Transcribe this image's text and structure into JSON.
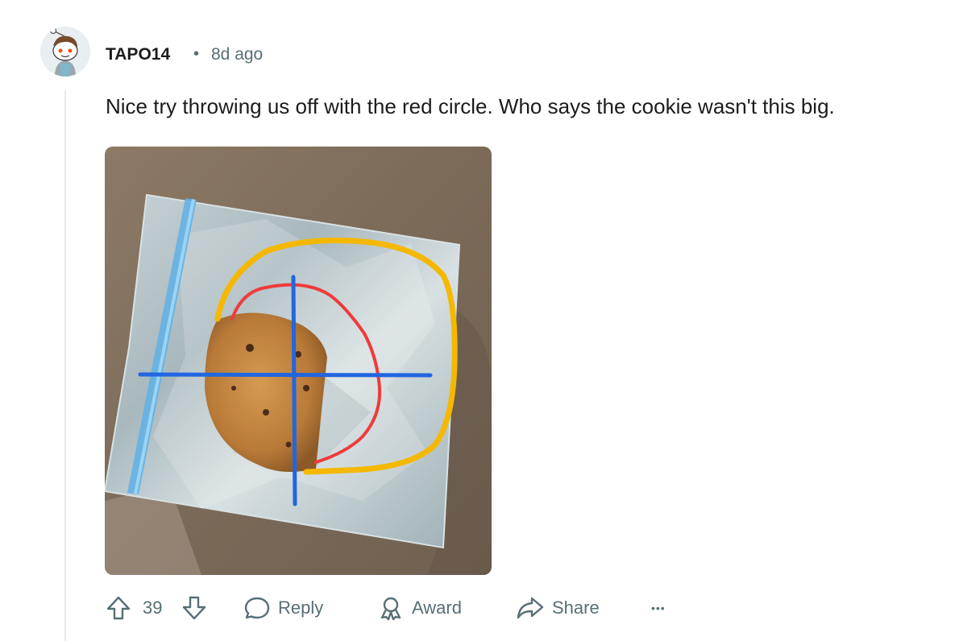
{
  "comment": {
    "username": "TAPO14",
    "separator": "•",
    "timestamp": "8d ago",
    "text": "Nice try throwing us off with the red circle. Who says the cookie wasn't this big."
  },
  "actions": {
    "vote_count": "39",
    "reply_label": "Reply",
    "award_label": "Award",
    "share_label": "Share",
    "more_label": "•••"
  },
  "colors": {
    "text": "#1c1c1c",
    "meta": "#576f76",
    "thread_line": "#e5ebee",
    "annotation_yellow": "#f5b800",
    "annotation_red": "#ef3b3b",
    "annotation_blue": "#2266e0"
  },
  "icons": [
    "avatar",
    "upvote-icon",
    "downvote-icon",
    "comment-bubble-icon",
    "award-icon",
    "share-arrow-icon",
    "more-icon"
  ]
}
